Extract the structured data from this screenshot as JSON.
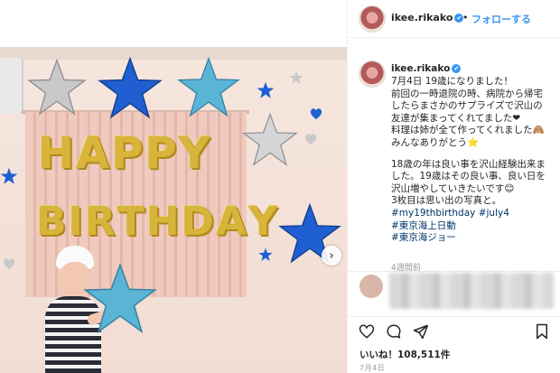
{
  "header": {
    "username": "ikee.rikako",
    "verified_mark": "✔",
    "separator": "•",
    "follow_label": "フォローする"
  },
  "photo": {
    "balloon_line1": [
      "H",
      "A",
      "P",
      "P",
      "Y"
    ],
    "balloon_line2": [
      "B",
      "I",
      "R",
      "T",
      "H",
      "D",
      "A",
      "Y"
    ],
    "next_arrow": "›"
  },
  "caption": {
    "username": "ikee.rikako",
    "lines": [
      "7月4日 19歳になりました！",
      "前回の一時退院の時、病院から帰宅",
      "したらまさかのサプライズで沢山の",
      "友達が集まってくれてました❤",
      "料理は姉が全て作ってくれました🙈",
      "みんなありがとう⭐",
      "",
      "18歳の年は良い事を沢山経験出来ま",
      "した。19歳はその良い事、良い日を",
      "沢山増やしていきたいです😊",
      "3枚目は思い出の写真と。"
    ],
    "hashtags": [
      "#my19thbirthday",
      "#july4",
      "#東京海上日動",
      "#東京海ジョー"
    ]
  },
  "time_ago": "4週間前",
  "likes": "いいね！108,511件",
  "post_date": "7月4日",
  "icons": [
    "heart-icon",
    "comment-icon",
    "share-icon",
    "bookmark-icon",
    "chevron-right-icon"
  ],
  "colors": {
    "link_blue": "#3897f0",
    "hashtag_blue": "#003569",
    "text": "#262626",
    "muted": "#999999",
    "balloon_gold": "#d8b43a",
    "star_blue": "#1f5fd1",
    "star_light_blue": "#5ab4d6",
    "star_silver": "#c9c9cc"
  }
}
